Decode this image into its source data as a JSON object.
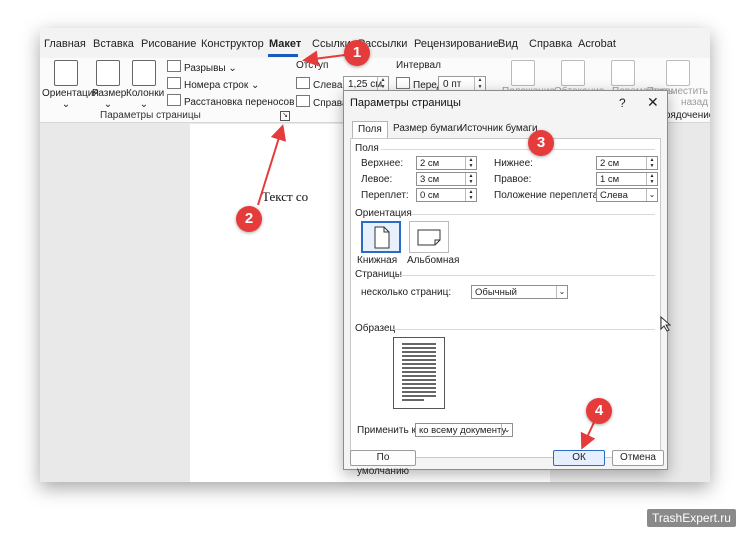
{
  "menu_tabs": [
    "Главная",
    "Вставка",
    "Рисование",
    "Конструктор",
    "Макет",
    "Ссылки",
    "Рассылки",
    "Рецензирование",
    "Вид",
    "Справка",
    "Acrobat"
  ],
  "active_tab": "Макет",
  "ribbon": {
    "orientation": "Ориентация",
    "size": "Размер",
    "columns": "Колонки",
    "breaks": "Разрывы",
    "line_numbers": "Номера строк",
    "hyphenation": "Расстановка переносов",
    "group_label": "Параметры страницы",
    "indent_header": "Отступ",
    "spacing_header": "Интервал",
    "indent_left_label": "Слева:",
    "indent_left_value": "1,25 см",
    "indent_right_label": "Справа:",
    "spacing_before_label": "Перед:",
    "spacing_before_value": "0 пт",
    "position": "Положение",
    "wrap_text": "Обтекание",
    "bring_forward": "Переместить",
    "send_backward": "Переместить назад",
    "arrange_label": "Упорядочение"
  },
  "document": {
    "text": "Текст со"
  },
  "dialog": {
    "title": "Параметры страницы",
    "help": "?",
    "close": "✕",
    "tabs": [
      "Поля",
      "Размер бумаги",
      "Источник бумаги"
    ],
    "margins_section": "Поля",
    "top_label": "Верхнее:",
    "top_value": "2 см",
    "bottom_label": "Нижнее:",
    "bottom_value": "2 см",
    "left_label": "Левое:",
    "left_value": "3 см",
    "right_label": "Правое:",
    "right_value": "1 см",
    "gutter_label": "Переплет:",
    "gutter_value": "0 см",
    "gutter_pos_label": "Положение переплета:",
    "gutter_pos_value": "Слева",
    "orientation_section": "Ориентация",
    "portrait": "Книжная",
    "landscape": "Альбомная",
    "pages_section": "Страницы",
    "multiple_pages_label": "несколько страниц:",
    "multiple_pages_value": "Обычный",
    "preview_section": "Образец",
    "apply_to_label": "Применить к:",
    "apply_to_value": "ко всему документу",
    "default_button": "По умолчанию",
    "ok_button": "ОК",
    "cancel_button": "Отмена"
  },
  "markers": [
    "1",
    "2",
    "3",
    "4"
  ],
  "watermark": "TrashExpert.ru",
  "colors": {
    "marker": "#e63b3b",
    "accent": "#185abd"
  }
}
